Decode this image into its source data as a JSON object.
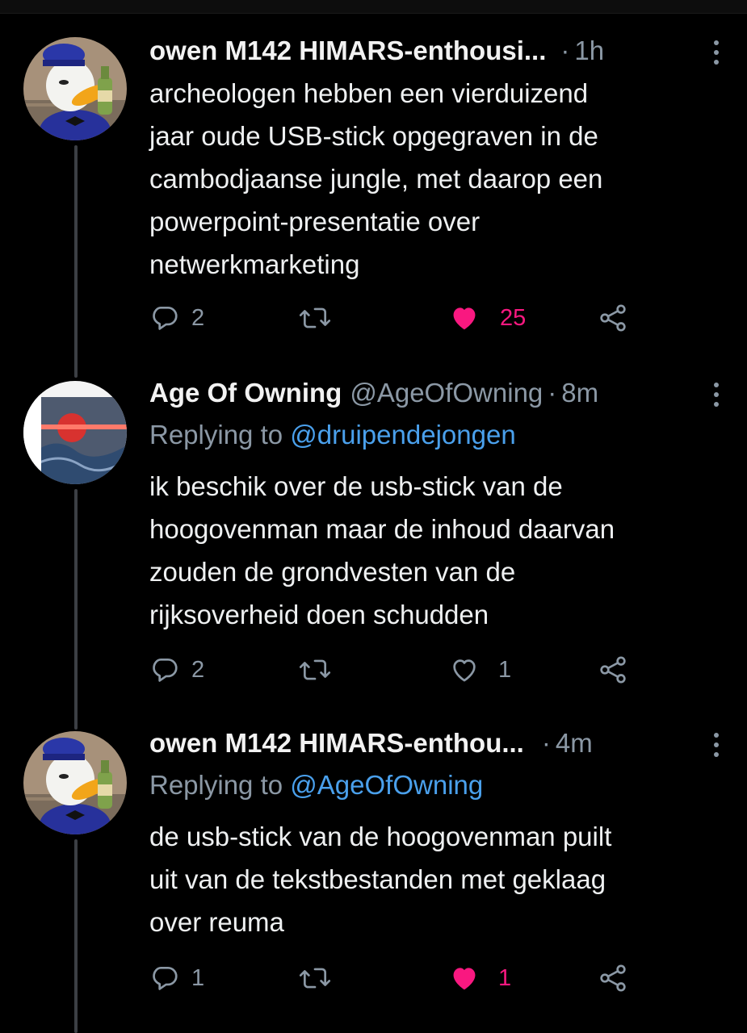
{
  "colors": {
    "background": "#000000",
    "text": "#eef0f1",
    "muted": "#8b98a5",
    "mention": "#4aa0ec",
    "like_active": "#f91880",
    "thread_line": "#3c3f44"
  },
  "tweets": [
    {
      "name": "owen M142 HIMARS-enthousi...",
      "handle": "",
      "dot": "·",
      "time": "1h",
      "replying_prefix": "",
      "replying_mention": "",
      "lines": [
        "archeologen hebben een vierduizend",
        "jaar oude USB-stick opgegraven in de",
        "cambodjaanse jungle, met daarop een",
        "powerpoint-presentatie over",
        "netwerkmarketing"
      ],
      "replies": "2",
      "retweets": "",
      "likes": "25",
      "liked": true,
      "icons": {
        "reply": "comment-icon",
        "retweet": "retweet-icon",
        "like": "heart-filled-icon",
        "share": "share-icon",
        "more": "more-vertical-icon"
      }
    },
    {
      "name": "Age Of Owning",
      "handle": "@AgeOfOwning",
      "dot": "·",
      "time": "8m",
      "replying_prefix": "Replying to",
      "replying_mention": "@druipendejongen",
      "lines": [
        "ik beschik over de usb-stick van de",
        "hoogovenman maar de inhoud daarvan",
        "zouden de grondvesten van de",
        "rijksoverheid doen schudden"
      ],
      "replies": "2",
      "retweets": "",
      "likes": "1",
      "liked": false,
      "icons": {
        "reply": "comment-icon",
        "retweet": "retweet-icon",
        "like": "heart-outline-icon",
        "share": "share-icon",
        "more": "more-vertical-icon"
      }
    },
    {
      "name": "owen M142 HIMARS-enthou...",
      "handle": "",
      "dot": "·",
      "time": "4m",
      "replying_prefix": "Replying to",
      "replying_mention": "@AgeOfOwning",
      "lines": [
        "de usb-stick van de hoogovenman puilt",
        "uit van de tekstbestanden met geklaag",
        "over reuma"
      ],
      "replies": "1",
      "retweets": "",
      "likes": "1",
      "liked": true,
      "icons": {
        "reply": "comment-icon",
        "retweet": "retweet-icon",
        "like": "heart-filled-icon",
        "share": "share-icon",
        "more": "more-vertical-icon"
      }
    }
  ]
}
